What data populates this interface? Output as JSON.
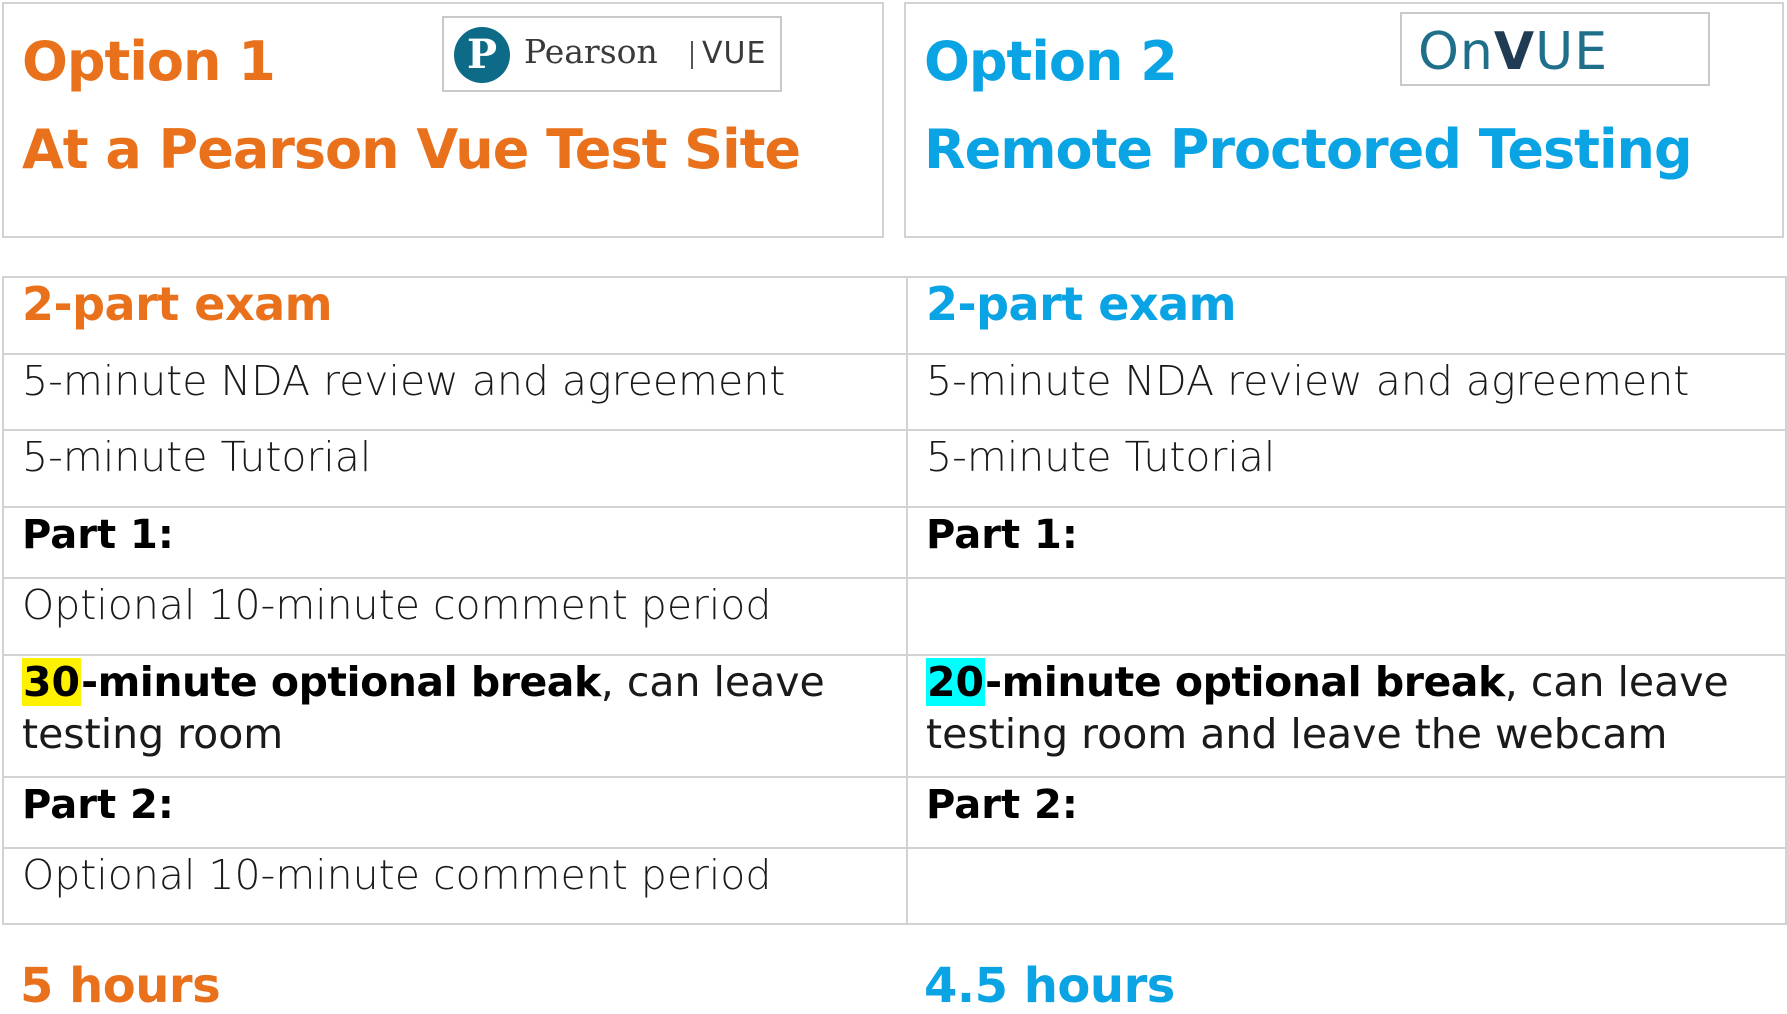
{
  "option1": {
    "label": "Option 1",
    "subtitle": "At a Pearson Vue Test Site",
    "logo": {
      "initial": "P",
      "brand": "Pearson",
      "suffix": "VUE"
    },
    "accent_color": "#e9711c",
    "exam_title": "2-part exam",
    "nda": "5-minute NDA review and agreement",
    "tutorial": "5-minute Tutorial",
    "part1_label": "Part 1:",
    "part1_comment": "Optional 10-minute comment period",
    "break_number": "30",
    "break_bold": "-minute optional break",
    "break_rest": ", can leave testing room",
    "break_highlight_color": "#fff200",
    "part2_label": "Part 2:",
    "part2_comment": "Optional 10-minute comment period",
    "total": "5 hours"
  },
  "option2": {
    "label": "Option 2",
    "subtitle": "Remote Proctored Testing",
    "logo": {
      "prefix": "On",
      "v": "V",
      "suffix": "UE"
    },
    "accent_color": "#0aa3e3",
    "exam_title": "2-part exam",
    "nda": "5-minute NDA review and agreement",
    "tutorial": "5-minute Tutorial",
    "part1_label": "Part 1:",
    "part1_comment": "",
    "break_number": "20",
    "break_bold": "-minute optional break",
    "break_rest": ", can leave testing room and leave the webcam",
    "break_highlight_color": "#00ffff",
    "part2_label": "Part 2:",
    "part2_comment": "",
    "total": "4.5 hours"
  }
}
